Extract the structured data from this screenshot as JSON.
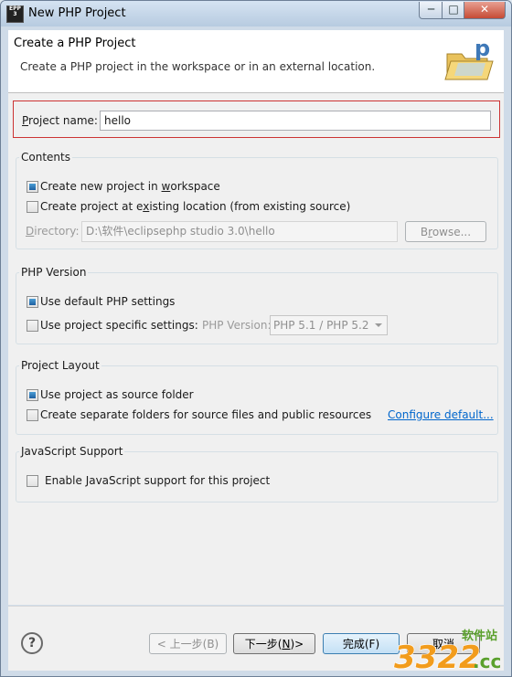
{
  "window": {
    "title": "New PHP Project",
    "app_icon_text": "EPP",
    "app_icon_sub": "3",
    "minimize": "─",
    "maximize": "□",
    "close": "✕"
  },
  "header": {
    "title": "Create a PHP Project",
    "description": "Create a PHP project in the workspace or in an external location."
  },
  "project_name": {
    "label_u": "P",
    "label_rest": "roject name:",
    "value": "hello"
  },
  "contents": {
    "title": "Contents",
    "option_new_pre": "Create new project in ",
    "option_new_u": "w",
    "option_new_post": "orkspace",
    "option_new_checked": true,
    "option_existing_pre": "Create project at e",
    "option_existing_u": "x",
    "option_existing_post": "isting location (from existing source)",
    "option_existing_checked": false,
    "directory_label_u": "D",
    "directory_label_rest": "irectory:",
    "directory_value": "D:\\软件\\eclipsephp studio 3.0\\hello",
    "browse_pre": "B",
    "browse_u": "r",
    "browse_post": "owse..."
  },
  "php_version": {
    "title": "PHP Version",
    "use_default": "Use default PHP settings",
    "use_default_checked": true,
    "use_specific": "Use project specific settings:",
    "use_specific_checked": false,
    "version_label": "PHP Version:",
    "version_value": "PHP 5.1 / PHP 5.2"
  },
  "project_layout": {
    "title": "Project Layout",
    "source_folder": "Use project as source folder",
    "source_folder_checked": true,
    "separate_folders": "Create separate folders for source files and public resources",
    "separate_folders_checked": false,
    "configure_link": "Configure default..."
  },
  "javascript": {
    "title": "JavaScript Support",
    "enable": "Enable JavaScript support for this project",
    "enable_checked": false
  },
  "footer": {
    "help": "?",
    "back": "< 上一步(B)",
    "next_pre": "下一步(",
    "next_u": "N",
    "next_post": ")>",
    "finish": "完成(F)",
    "cancel": "取消"
  },
  "watermark": {
    "top": "软件站",
    "number": "3322",
    "suffix": ".cc"
  },
  "colors": {
    "accent": "#1e5fa0",
    "link": "#0066cc",
    "error_border": "#cc3333"
  }
}
